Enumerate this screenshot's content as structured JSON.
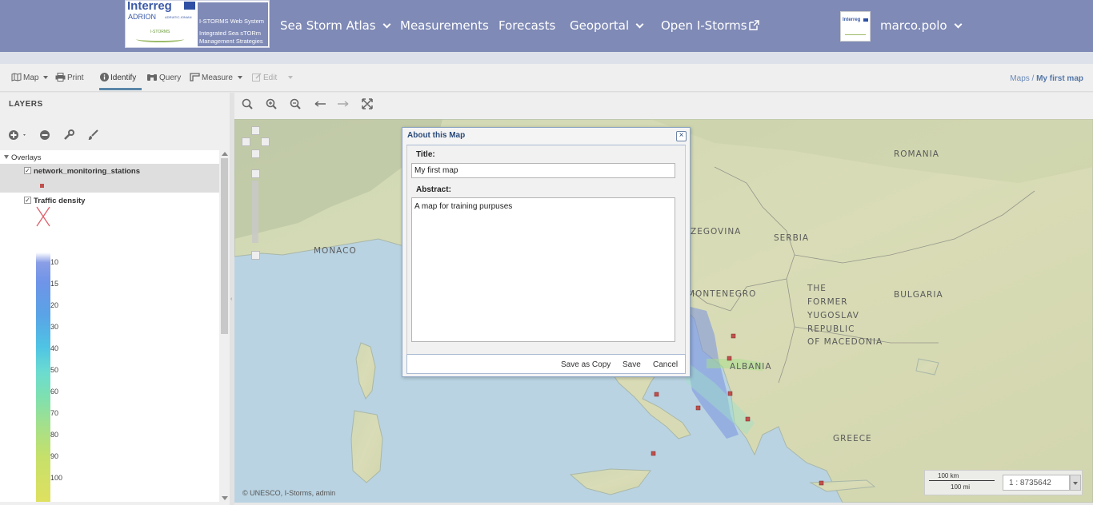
{
  "header": {
    "logo": {
      "brand": "Interreg",
      "program": "ADRION",
      "program_sub": "ADRIATIC-IONIAN",
      "project": "I-STORMS",
      "system_title": "I-STORMS Web System",
      "system_subtitle_1": "Integrated Sea sTORm",
      "system_subtitle_2": "Management Strategies"
    },
    "nav": [
      {
        "label": "Sea Storm Atlas",
        "has_caret": true
      },
      {
        "label": "Measurements",
        "has_caret": false
      },
      {
        "label": "Forecasts",
        "has_caret": false
      },
      {
        "label": "Geoportal",
        "has_caret": true
      },
      {
        "label": "Open I-Storms",
        "has_caret": false,
        "icon": "external-link-icon"
      }
    ],
    "user": {
      "name": "marco.polo",
      "avatar_text": "Interreg"
    }
  },
  "toolbar": {
    "items": [
      {
        "label": "Map",
        "icon": "map-icon",
        "dropdown": true
      },
      {
        "label": "Print",
        "icon": "print-icon"
      },
      {
        "label": "Identify",
        "icon": "info-icon",
        "active": true
      },
      {
        "label": "Query",
        "icon": "binoculars-icon"
      },
      {
        "label": "Measure",
        "icon": "ruler-icon",
        "dropdown": true
      },
      {
        "label": "Edit",
        "icon": "edit-icon",
        "dropdown": true,
        "disabled": true
      }
    ],
    "breadcrumb": {
      "parent": "Maps",
      "separator": "/",
      "current": "My first map"
    }
  },
  "layers": {
    "title": "LAYERS",
    "group": "Overlays",
    "items": [
      {
        "name": "network_monitoring_stations",
        "checked": true,
        "symbol": "square",
        "color": "#c0504d"
      },
      {
        "name": "Traffic density",
        "checked": true,
        "symbol": "x",
        "color": "#e0606a"
      }
    ],
    "legend_values": [
      "10",
      "15",
      "20",
      "30",
      "40",
      "50",
      "60",
      "70",
      "80",
      "90",
      "100"
    ]
  },
  "map": {
    "labels": [
      "ROMANIA",
      "SERBIA",
      "ZEGOVINA",
      "MONACO",
      "MONTENEGRO",
      "BULGARIA",
      "THE",
      "FORMER",
      "YUGOSLAV",
      "REPUBLIC",
      "OF MACEDONIA",
      "ALBANIA",
      "GREECE"
    ],
    "copyright": "© UNESCO, I-Storms, admin",
    "scale": {
      "km": "100 km",
      "mi": "100 mi",
      "ratio": "1 : 8735642"
    }
  },
  "dialog": {
    "title": "About this Map",
    "close": "×",
    "title_label": "Title:",
    "title_value": "My first map",
    "abstract_label": "Abstract:",
    "abstract_value": "A map for training purpuses",
    "buttons": {
      "save_copy": "Save as Copy",
      "save": "Save",
      "cancel": "Cancel"
    }
  },
  "colors": {
    "navbar": "#7f8ab6",
    "accent": "#5a86a8",
    "station": "#c0504d"
  }
}
